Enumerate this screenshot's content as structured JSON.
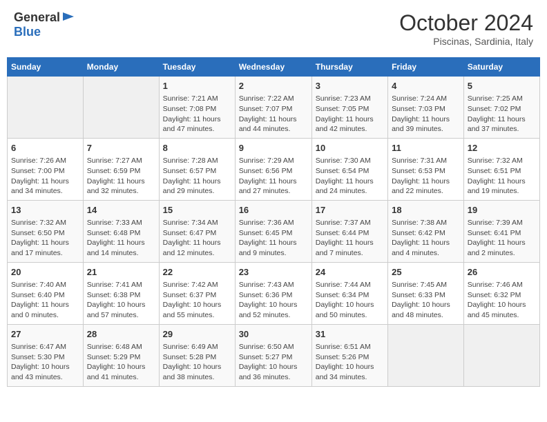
{
  "header": {
    "logo_general": "General",
    "logo_blue": "Blue",
    "month_title": "October 2024",
    "subtitle": "Piscinas, Sardinia, Italy"
  },
  "weekdays": [
    "Sunday",
    "Monday",
    "Tuesday",
    "Wednesday",
    "Thursday",
    "Friday",
    "Saturday"
  ],
  "weeks": [
    [
      {
        "day": "",
        "info": ""
      },
      {
        "day": "",
        "info": ""
      },
      {
        "day": "1",
        "info": "Sunrise: 7:21 AM\nSunset: 7:08 PM\nDaylight: 11 hours and 47 minutes."
      },
      {
        "day": "2",
        "info": "Sunrise: 7:22 AM\nSunset: 7:07 PM\nDaylight: 11 hours and 44 minutes."
      },
      {
        "day": "3",
        "info": "Sunrise: 7:23 AM\nSunset: 7:05 PM\nDaylight: 11 hours and 42 minutes."
      },
      {
        "day": "4",
        "info": "Sunrise: 7:24 AM\nSunset: 7:03 PM\nDaylight: 11 hours and 39 minutes."
      },
      {
        "day": "5",
        "info": "Sunrise: 7:25 AM\nSunset: 7:02 PM\nDaylight: 11 hours and 37 minutes."
      }
    ],
    [
      {
        "day": "6",
        "info": "Sunrise: 7:26 AM\nSunset: 7:00 PM\nDaylight: 11 hours and 34 minutes."
      },
      {
        "day": "7",
        "info": "Sunrise: 7:27 AM\nSunset: 6:59 PM\nDaylight: 11 hours and 32 minutes."
      },
      {
        "day": "8",
        "info": "Sunrise: 7:28 AM\nSunset: 6:57 PM\nDaylight: 11 hours and 29 minutes."
      },
      {
        "day": "9",
        "info": "Sunrise: 7:29 AM\nSunset: 6:56 PM\nDaylight: 11 hours and 27 minutes."
      },
      {
        "day": "10",
        "info": "Sunrise: 7:30 AM\nSunset: 6:54 PM\nDaylight: 11 hours and 24 minutes."
      },
      {
        "day": "11",
        "info": "Sunrise: 7:31 AM\nSunset: 6:53 PM\nDaylight: 11 hours and 22 minutes."
      },
      {
        "day": "12",
        "info": "Sunrise: 7:32 AM\nSunset: 6:51 PM\nDaylight: 11 hours and 19 minutes."
      }
    ],
    [
      {
        "day": "13",
        "info": "Sunrise: 7:32 AM\nSunset: 6:50 PM\nDaylight: 11 hours and 17 minutes."
      },
      {
        "day": "14",
        "info": "Sunrise: 7:33 AM\nSunset: 6:48 PM\nDaylight: 11 hours and 14 minutes."
      },
      {
        "day": "15",
        "info": "Sunrise: 7:34 AM\nSunset: 6:47 PM\nDaylight: 11 hours and 12 minutes."
      },
      {
        "day": "16",
        "info": "Sunrise: 7:36 AM\nSunset: 6:45 PM\nDaylight: 11 hours and 9 minutes."
      },
      {
        "day": "17",
        "info": "Sunrise: 7:37 AM\nSunset: 6:44 PM\nDaylight: 11 hours and 7 minutes."
      },
      {
        "day": "18",
        "info": "Sunrise: 7:38 AM\nSunset: 6:42 PM\nDaylight: 11 hours and 4 minutes."
      },
      {
        "day": "19",
        "info": "Sunrise: 7:39 AM\nSunset: 6:41 PM\nDaylight: 11 hours and 2 minutes."
      }
    ],
    [
      {
        "day": "20",
        "info": "Sunrise: 7:40 AM\nSunset: 6:40 PM\nDaylight: 11 hours and 0 minutes."
      },
      {
        "day": "21",
        "info": "Sunrise: 7:41 AM\nSunset: 6:38 PM\nDaylight: 10 hours and 57 minutes."
      },
      {
        "day": "22",
        "info": "Sunrise: 7:42 AM\nSunset: 6:37 PM\nDaylight: 10 hours and 55 minutes."
      },
      {
        "day": "23",
        "info": "Sunrise: 7:43 AM\nSunset: 6:36 PM\nDaylight: 10 hours and 52 minutes."
      },
      {
        "day": "24",
        "info": "Sunrise: 7:44 AM\nSunset: 6:34 PM\nDaylight: 10 hours and 50 minutes."
      },
      {
        "day": "25",
        "info": "Sunrise: 7:45 AM\nSunset: 6:33 PM\nDaylight: 10 hours and 48 minutes."
      },
      {
        "day": "26",
        "info": "Sunrise: 7:46 AM\nSunset: 6:32 PM\nDaylight: 10 hours and 45 minutes."
      }
    ],
    [
      {
        "day": "27",
        "info": "Sunrise: 6:47 AM\nSunset: 5:30 PM\nDaylight: 10 hours and 43 minutes."
      },
      {
        "day": "28",
        "info": "Sunrise: 6:48 AM\nSunset: 5:29 PM\nDaylight: 10 hours and 41 minutes."
      },
      {
        "day": "29",
        "info": "Sunrise: 6:49 AM\nSunset: 5:28 PM\nDaylight: 10 hours and 38 minutes."
      },
      {
        "day": "30",
        "info": "Sunrise: 6:50 AM\nSunset: 5:27 PM\nDaylight: 10 hours and 36 minutes."
      },
      {
        "day": "31",
        "info": "Sunrise: 6:51 AM\nSunset: 5:26 PM\nDaylight: 10 hours and 34 minutes."
      },
      {
        "day": "",
        "info": ""
      },
      {
        "day": "",
        "info": ""
      }
    ]
  ]
}
